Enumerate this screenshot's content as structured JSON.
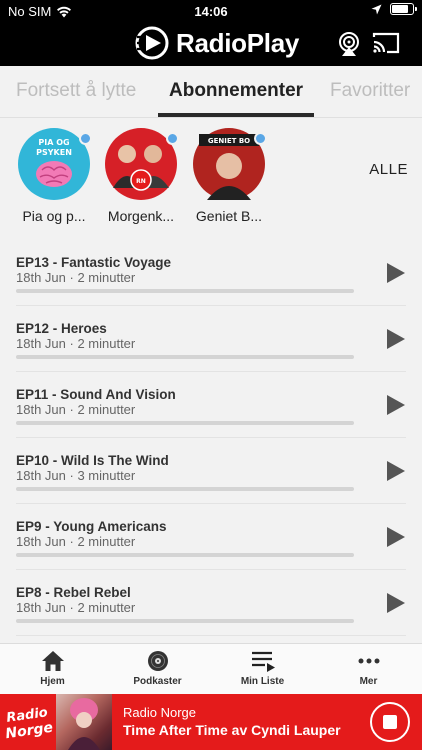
{
  "status": {
    "carrier": "No SIM",
    "time": "14:06",
    "battery_level": 0.85
  },
  "header": {
    "brand": "RadioPlay"
  },
  "tabs": [
    {
      "label": "Fortsett å lytte",
      "active": false
    },
    {
      "label": "Abonnementer",
      "active": true
    },
    {
      "label": "Favoritter",
      "active": false
    }
  ],
  "subscriptions": {
    "items": [
      {
        "label": "Pia og p...",
        "art_text": "PIA OG PSYKEN"
      },
      {
        "label": "Morgenk...",
        "art_text": "Radio Norge"
      },
      {
        "label": "Geniet B...",
        "art_text": "GENIET BO"
      }
    ],
    "see_all": "ALLE"
  },
  "episodes": [
    {
      "title": "EP13 - Fantastic Voyage",
      "date": "18th Jun",
      "duration": "2 minutter"
    },
    {
      "title": "EP12 - Heroes",
      "date": "18th Jun",
      "duration": "2 minutter"
    },
    {
      "title": "EP11 - Sound And Vision",
      "date": "18th Jun",
      "duration": "2 minutter"
    },
    {
      "title": "EP10 - Wild Is The Wind",
      "date": "18th Jun",
      "duration": "3 minutter"
    },
    {
      "title": "EP9 - Young Americans",
      "date": "18th Jun",
      "duration": "2 minutter"
    },
    {
      "title": "EP8 - Rebel Rebel",
      "date": "18th Jun",
      "duration": "2 minutter"
    }
  ],
  "nav": [
    {
      "label": "Hjem",
      "icon": "home-icon"
    },
    {
      "label": "Podkaster",
      "icon": "vinyl-icon"
    },
    {
      "label": "Min Liste",
      "icon": "playlist-icon"
    },
    {
      "label": "Mer",
      "icon": "more-icon"
    }
  ],
  "player": {
    "logo_line1": "Radio",
    "logo_line2": "Norge",
    "station": "Radio Norge",
    "song": "Time After Time av Cyndi Lauper"
  },
  "colors": {
    "accent": "#e41b1b",
    "badge": "#5aa7e6",
    "header_bg": "#000000"
  }
}
